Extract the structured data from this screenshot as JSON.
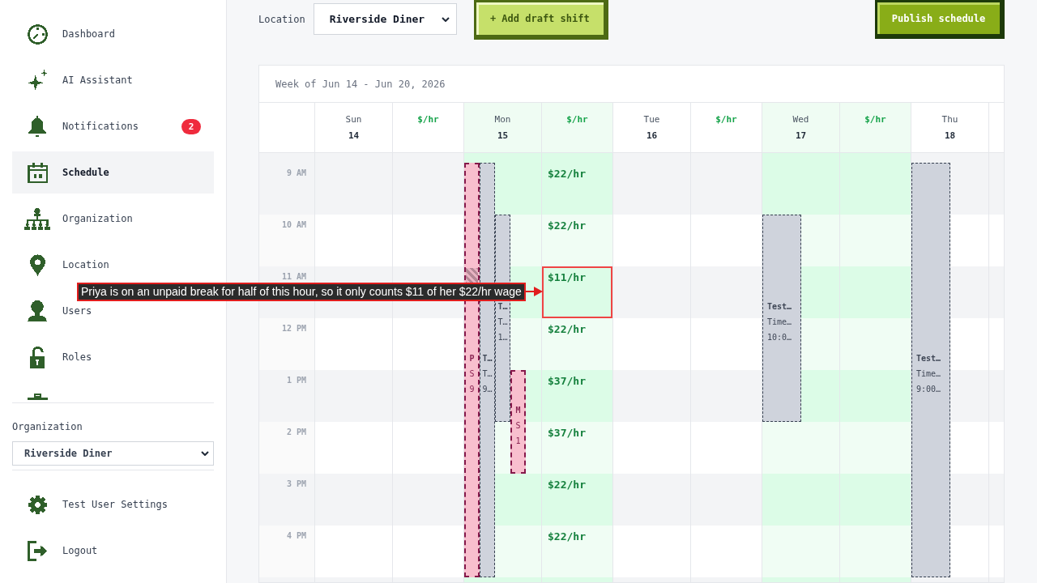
{
  "sidebar": {
    "nav": [
      {
        "label": "Dashboard",
        "selected": false
      },
      {
        "label": "AI Assistant",
        "selected": false
      },
      {
        "label": "Notifications",
        "selected": false,
        "badge": "2"
      },
      {
        "label": "Schedule",
        "selected": true
      },
      {
        "label": "Organization",
        "selected": false
      },
      {
        "label": "Location",
        "selected": false
      },
      {
        "label": "Users",
        "selected": false
      },
      {
        "label": "Roles",
        "selected": false
      }
    ],
    "organization": {
      "label": "Organization",
      "value": "Riverside Diner"
    },
    "footer": [
      {
        "label": "Test User Settings"
      },
      {
        "label": "Logout"
      }
    ]
  },
  "toolbar": {
    "location_label": "Location",
    "location_value": "Riverside Diner",
    "add_button": "+ Add draft shift",
    "publish_button": "Publish schedule"
  },
  "calendar": {
    "title": "Week of Jun 14 - Jun 20, 2026",
    "hours": [
      "9 AM",
      "10 AM",
      "11 AM",
      "12 PM",
      "1 PM",
      "2 PM",
      "3 PM",
      "4 PM"
    ],
    "days": [
      {
        "name": "Sun",
        "date": "14",
        "rate_label": "$/hr",
        "highlighted": false
      },
      {
        "name": "Mon",
        "date": "15",
        "rate_label": "$/hr",
        "highlighted": true,
        "rates": [
          {
            "value": "$22/hr",
            "highlighted": false
          },
          {
            "value": "$22/hr",
            "highlighted": false
          },
          {
            "value": "$11/hr",
            "highlighted": true
          },
          {
            "value": "$22/hr",
            "highlighted": false
          },
          {
            "value": "$37/hr",
            "highlighted": false
          },
          {
            "value": "$37/hr",
            "highlighted": false
          },
          {
            "value": "$22/hr",
            "highlighted": false
          },
          {
            "value": "$22/hr",
            "highlighted": false
          }
        ],
        "shifts": [
          {
            "kind": "flagged",
            "unpaid_break": true,
            "lines": [
              "P",
              "S",
              "9"
            ]
          },
          {
            "kind": "plain",
            "unpaid_break": false,
            "lines": [
              "T…",
              "T…",
              "9…"
            ]
          },
          {
            "kind": "plain",
            "unpaid_break": false,
            "lines": [
              "T…",
              "T…",
              "1…"
            ]
          },
          {
            "kind": "flagged",
            "unpaid_break": false,
            "lines": [
              "M",
              "S",
              "1"
            ]
          }
        ]
      },
      {
        "name": "Tue",
        "date": "16",
        "rate_label": "$/hr",
        "highlighted": false
      },
      {
        "name": "Wed",
        "date": "17",
        "rate_label": "$/hr",
        "highlighted": true,
        "shifts": [
          {
            "kind": "plain",
            "unpaid_break": false,
            "lines": [
              "Test…",
              "Time…",
              "10:0…"
            ]
          }
        ]
      },
      {
        "name": "Thu",
        "date": "18",
        "highlighted": false,
        "shifts": [
          {
            "kind": "plain",
            "unpaid_break": false,
            "lines": [
              "Test…",
              "Time…",
              "9:00…"
            ]
          }
        ]
      }
    ]
  },
  "annotation": {
    "text": "Priya is on an unpaid break for half of this hour, so it only counts $11 of her $22/hr wage"
  }
}
